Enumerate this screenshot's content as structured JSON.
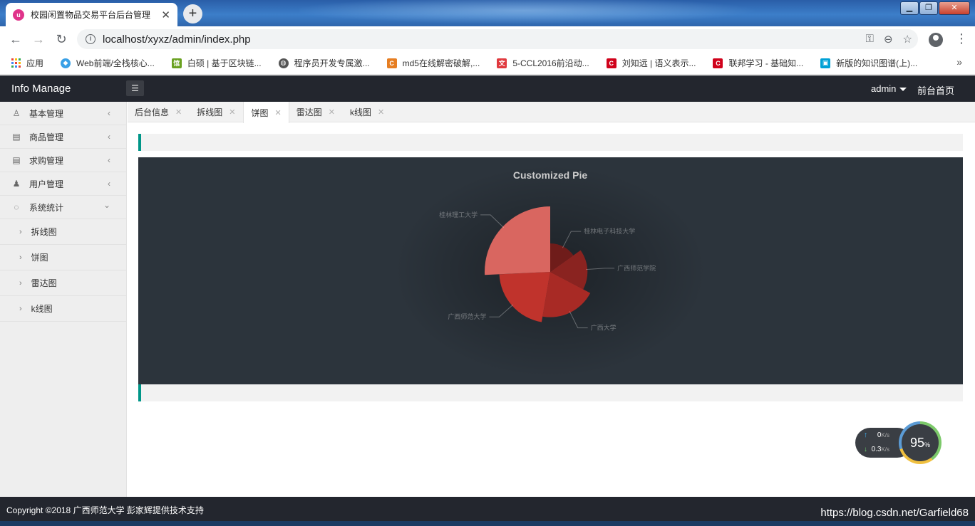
{
  "browser": {
    "tab_title": "校园闲置物品交易平台后台管理",
    "url": "localhost/xyxz/admin/index.php",
    "bookmarks": [
      {
        "label": "应用",
        "color": "#e74c3c"
      },
      {
        "label": "Web前端/全栈核心...",
        "color": "#3aa0e6"
      },
      {
        "label": "白硕 | 基于区块链...",
        "color": "#6aa121"
      },
      {
        "label": "程序员开发专属激...",
        "color": "#555555"
      },
      {
        "label": "md5在线解密破解,...",
        "color": "#e67e22"
      },
      {
        "label": "5-CCL2016前沿动...",
        "color": "#e0393e"
      },
      {
        "label": "刘知远 | 语义表示...",
        "color": "#d0021b"
      },
      {
        "label": "联邦学习 - 基础知...",
        "color": "#d0021b"
      },
      {
        "label": "新版的知识图谱(上)...",
        "color": "#00a1d6"
      }
    ]
  },
  "header": {
    "brand": "Info Manage",
    "user": "admin",
    "home_link": "前台首页"
  },
  "sidebar": {
    "items": [
      {
        "label": "基本管理",
        "icon": "user-icon"
      },
      {
        "label": "商品管理",
        "icon": "document-icon"
      },
      {
        "label": "求购管理",
        "icon": "document-icon"
      },
      {
        "label": "用户管理",
        "icon": "users-icon"
      },
      {
        "label": "系统统计",
        "icon": "chart-icon"
      }
    ],
    "subitems": [
      "拆线图",
      "饼图",
      "雷达图",
      "k线图"
    ]
  },
  "content_tabs": [
    {
      "label": "后台信息",
      "active": false
    },
    {
      "label": "拆线图",
      "active": false
    },
    {
      "label": "饼图",
      "active": true
    },
    {
      "label": "雷达图",
      "active": false
    },
    {
      "label": "k线图",
      "active": false
    }
  ],
  "chart_data": {
    "type": "pie",
    "title": "Customized Pie",
    "style": "rose",
    "categories": [
      "桂林电子科技大学",
      "广西师范学院",
      "广西大学",
      "广西师范大学",
      "桂林理工大学"
    ],
    "values": [
      235,
      274,
      310,
      335,
      400
    ],
    "colors": [
      "#6f1c1a",
      "#8a2320",
      "#a82a25",
      "#c0332c",
      "#d96660"
    ],
    "background": "#2c343c"
  },
  "footer": {
    "copyright": "Copyright ©2018 广西师范大学 彭家辉提供技术支持",
    "watermark": "https://blog.csdn.net/Garfield68"
  },
  "speed_widget": {
    "up": "0",
    "up_unit": "K/s",
    "down": "0.3",
    "down_unit": "K/s",
    "percent": "95",
    "percent_unit": "%"
  }
}
